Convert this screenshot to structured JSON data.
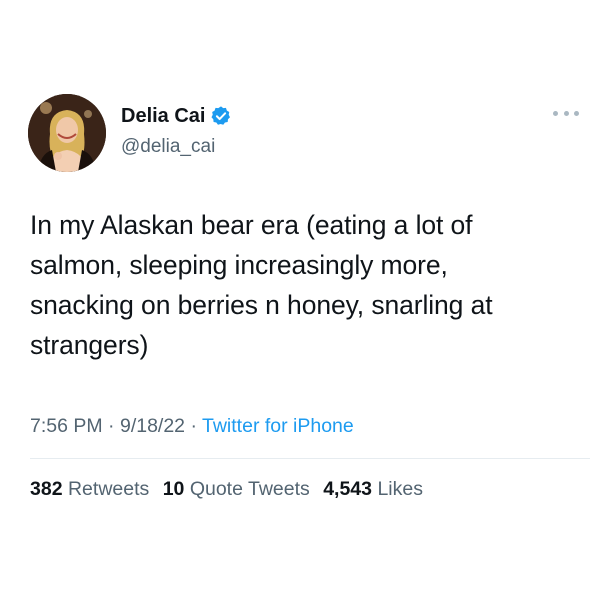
{
  "author": {
    "display_name": "Delia Cai",
    "handle": "@delia_cai",
    "verified": true,
    "verified_icon": "verified-badge-icon",
    "avatar": "profile-photo"
  },
  "tweet": {
    "lines": [
      "In my Alaskan bear era (eating a lot of",
      "salmon, sleeping increasingly more,",
      "snacking on berries n honey, snarling at",
      "strangers)"
    ]
  },
  "meta": {
    "time": "7:56 PM",
    "sep1": " · ",
    "date": "9/18/22",
    "sep2": " · ",
    "source": "Twitter for iPhone"
  },
  "stats": {
    "retweets_count": "382",
    "retweets_label": "Retweets",
    "quotes_count": "10",
    "quotes_label": "Quote Tweets",
    "likes_count": "4,543",
    "likes_label": "Likes"
  },
  "colors": {
    "text": "#0f1419",
    "secondary": "#536471",
    "link": "#1d9bf0",
    "verified": "#1d9bf0",
    "divider": "#e6ecf0"
  },
  "icons": {
    "more": "more-dots-icon"
  }
}
